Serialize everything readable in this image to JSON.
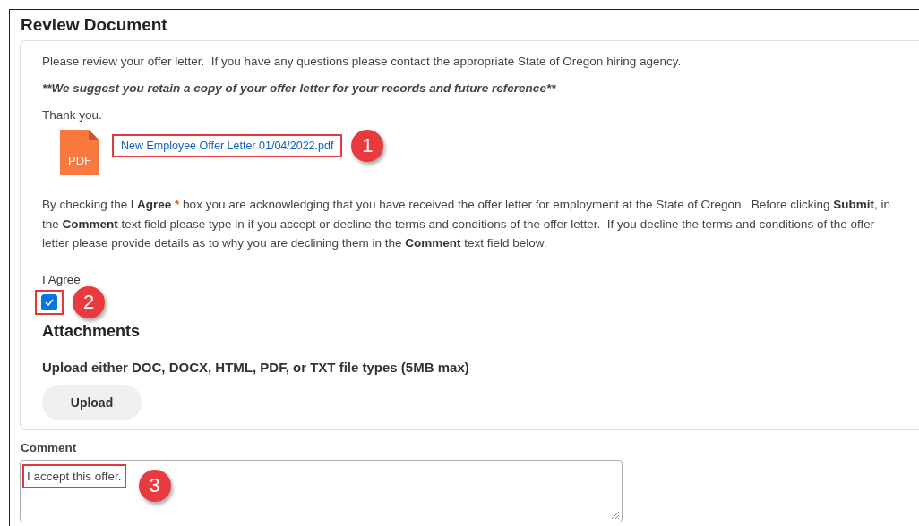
{
  "title": "Review Document",
  "intro": "Please review your offer letter.  If you have any questions please contact the appropriate State of Oregon hiring agency.",
  "notice": "**We suggest you retain a copy of your offer letter for your records and future reference**",
  "thanks": "Thank you.",
  "attachment": {
    "file_type": "PDF",
    "link": "New Employee Offer Letter 01/04/2022.pdf",
    "callout": "1"
  },
  "instructions": [
    {
      "kind": "plain",
      "text": "By checking the "
    },
    {
      "kind": "bold",
      "text": "I Agree"
    },
    {
      "kind": "required",
      "text": " *"
    },
    {
      "kind": "plain",
      "text": " box you are acknowledging that you have received the offer letter for employment at the State of Oregon.  Before clicking "
    },
    {
      "kind": "bold",
      "text": "Submit"
    },
    {
      "kind": "plain",
      "text": ", in the "
    },
    {
      "kind": "bold",
      "text": "Comment"
    },
    {
      "kind": "plain",
      "text": " text field please type in if you accept or decline the terms and conditions of the offer letter.  If you decline the terms and conditions of the offer letter please provide details as to why you are declining them in the "
    },
    {
      "kind": "bold",
      "text": "Comment"
    },
    {
      "kind": "plain",
      "text": " text field below."
    }
  ],
  "agree": {
    "label": "I Agree",
    "checked": true,
    "callout": "2"
  },
  "attachments": {
    "heading": "Attachments",
    "hint": "Upload either DOC, DOCX, HTML, PDF, or TXT file types (5MB max)",
    "button": "Upload"
  },
  "comment": {
    "label": "Comment",
    "value": "I accept this offer.",
    "callout": "3"
  }
}
